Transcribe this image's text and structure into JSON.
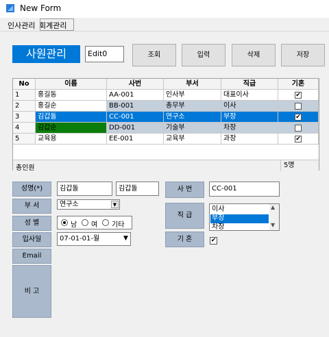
{
  "window": {
    "title": "New Form",
    "icon": "app-form-icon"
  },
  "menu": {
    "items": [
      "인사관리",
      "회계관리"
    ]
  },
  "toolbar": {
    "page_title": "사원관리",
    "edit0_value": "Edit0",
    "search_label": "조회",
    "input_label": "입력",
    "delete_label": "삭제",
    "save_label": "저장"
  },
  "grid": {
    "columns": [
      "No",
      "이름",
      "사번",
      "부서",
      "직급",
      "기혼"
    ],
    "rows": [
      {
        "no": "1",
        "name": "홍길동",
        "empno": "AA-001",
        "dept": "인사부",
        "rank": "대표이사",
        "married": true
      },
      {
        "no": "2",
        "name": "홍길순",
        "empno": "BB-001",
        "dept": "총무부",
        "rank": "이사",
        "married": false
      },
      {
        "no": "3",
        "name": "김갑돌",
        "empno": "CC-001",
        "dept": "연구소",
        "rank": "부장",
        "married": true
      },
      {
        "no": "4",
        "name": "김갑순",
        "empno": "DD-001",
        "dept": "기술부",
        "rank": "차장",
        "married": false
      },
      {
        "no": "5",
        "name": "교육용",
        "empno": "EE-001",
        "dept": "교육부",
        "rank": "과장",
        "married": true
      }
    ],
    "footer_label": "총인원",
    "footer_count": "5명"
  },
  "form": {
    "name_label": "성명(*)",
    "dept_label": "부 서",
    "gender_label": "성 별",
    "date_label": "입사일",
    "email_label": "Email",
    "memo_label": "비 고",
    "empno_label": "사 번",
    "rank_label": "직 급",
    "married_label": "기 혼",
    "name1_value": "김갑돌",
    "name2_value": "김갑돌",
    "empno_value": "CC-001",
    "dept_value": "연구소",
    "gender_options": [
      "남",
      "여",
      "기타"
    ],
    "gender_selected": "남",
    "date_value": "07-01-01-월",
    "rank_options": [
      "이사",
      "부장",
      "차장"
    ],
    "rank_selected": "부장",
    "married_checked": true
  },
  "colors": {
    "accent": "#0078d7",
    "label_bg": "#aab9cc",
    "row_alt": "#c4cfdc",
    "green_cell": "#0b7d0b"
  }
}
